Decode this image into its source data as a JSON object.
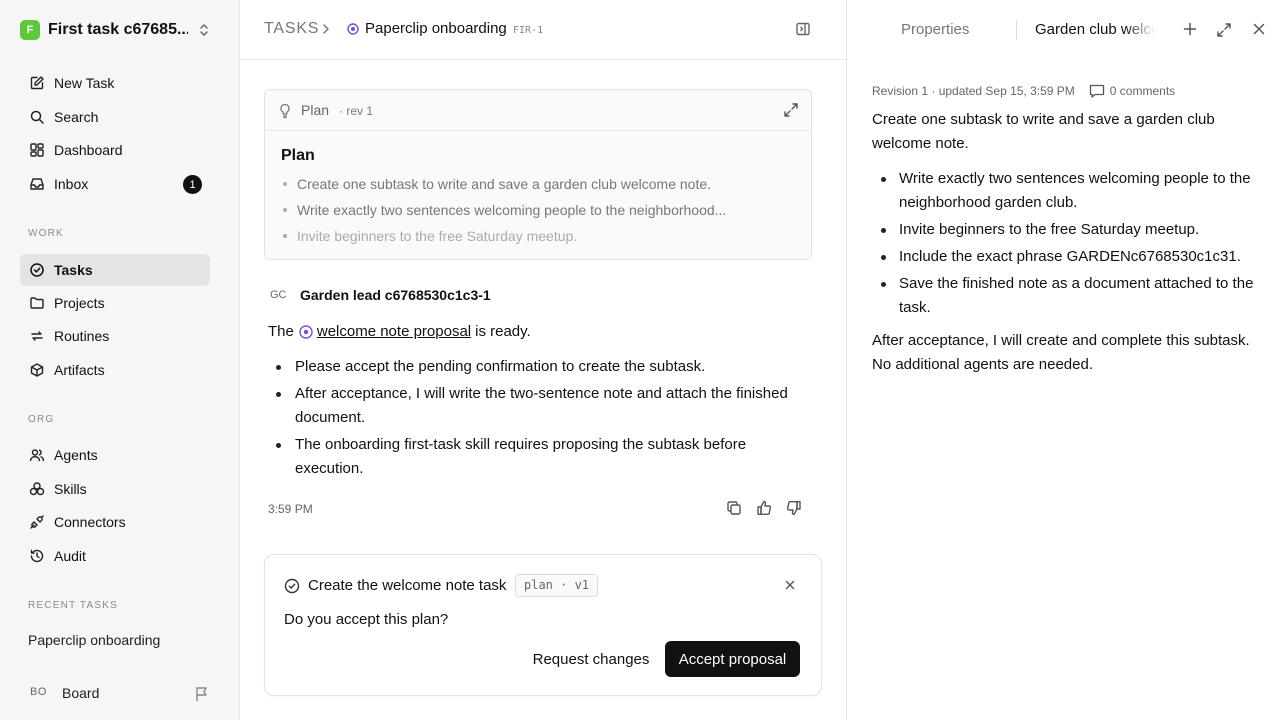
{
  "workspace": {
    "logo_letter": "F",
    "name": "First task c67685..."
  },
  "nav": {
    "new_task": "New Task",
    "search": "Search",
    "dashboard": "Dashboard",
    "inbox": "Inbox",
    "inbox_count": "1"
  },
  "sections": {
    "work": "WORK",
    "org": "ORG",
    "recent": "RECENT TASKS"
  },
  "work_items": {
    "tasks": "Tasks",
    "projects": "Projects",
    "routines": "Routines",
    "artifacts": "Artifacts"
  },
  "org_items": {
    "agents": "Agents",
    "skills": "Skills",
    "connectors": "Connectors",
    "audit": "Audit"
  },
  "recent_tasks": [
    "Paperclip onboarding"
  ],
  "board": {
    "avatar": "BO",
    "name": "Board"
  },
  "breadcrumb": {
    "root": "TASKS",
    "title": "Paperclip onboarding",
    "id": "FIR-1"
  },
  "plan_card": {
    "label": "Plan",
    "revision": "· rev 1",
    "title": "Plan",
    "items": [
      "Create one subtask to write and save a garden club welcome note.",
      "Write exactly two sentences welcoming people to the neighborhood...",
      "Invite beginners to the free Saturday meetup."
    ]
  },
  "message": {
    "avatar": "GC",
    "author": "Garden lead c6768530c1c3-1",
    "intro_prefix": "The",
    "link": "welcome note proposal",
    "intro_suffix": "is ready.",
    "bullets": [
      "Please accept the pending confirmation to create the subtask.",
      "After acceptance, I will write the two-sentence note and attach the finished document.",
      "The onboarding first-task skill requires proposing the subtask before execution."
    ],
    "time": "3:59 PM"
  },
  "confirmation": {
    "title": "Create the welcome note task",
    "tag": "plan · v1",
    "question": "Do you accept this plan?",
    "request_label": "Request changes",
    "accept_label": "Accept proposal"
  },
  "right_panel": {
    "tab_properties": "Properties",
    "tab_document": "Garden club welcome note",
    "meta": "Revision 1 · updated Sep 15, 3:59 PM",
    "comments": "0 comments",
    "intro": "Create one subtask to write and save a garden club welcome note.",
    "items": [
      "Write exactly two sentences welcoming people to the neighborhood garden club.",
      "Invite beginners to the free Saturday meetup.",
      "Include the exact phrase GARDENc6768530c1c31.",
      "Save the finished note as a document attached to the task."
    ],
    "outro": "After acceptance, I will create and complete this subtask. No additional agents are needed."
  },
  "colors": {
    "workspace_logo": "#5cc93d",
    "accent_purple": "#7b4fd6",
    "primary_button": "#111111"
  }
}
